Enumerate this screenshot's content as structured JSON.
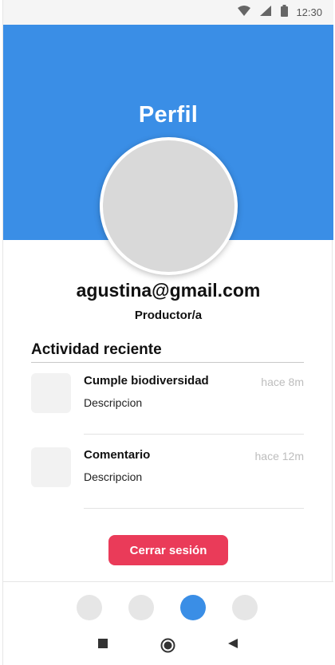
{
  "status_bar": {
    "time": "12:30",
    "icons": [
      "wifi-icon",
      "signal-icon",
      "battery-icon"
    ]
  },
  "header": {
    "title": "Perfil",
    "background_color": "#3a8ee6"
  },
  "profile": {
    "email": "agustina@gmail.com",
    "role": "Productor/a"
  },
  "activity": {
    "title": "Actividad reciente",
    "items": [
      {
        "title": "Cumple biodiversidad",
        "description": "Descripcion",
        "time": "hace 8m"
      },
      {
        "title": "Comentario",
        "description": "Descripcion",
        "time": "hace 12m"
      }
    ]
  },
  "logout": {
    "label": "Cerrar sesión",
    "color": "#ea3b59"
  },
  "bottom_nav": {
    "tabs": [
      "nav-tab-1",
      "nav-tab-2",
      "nav-tab-3",
      "nav-tab-4"
    ],
    "active_index": 2
  },
  "system_nav": [
    "recents-icon",
    "home-icon",
    "back-icon"
  ]
}
